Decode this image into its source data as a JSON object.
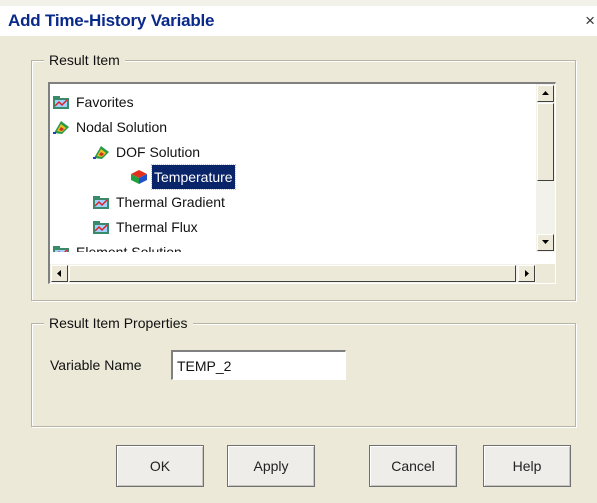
{
  "window": {
    "title": "Add Time-History Variable",
    "close_glyph": "×"
  },
  "result_item": {
    "group_label": "Result Item",
    "tree": [
      {
        "label": "Favorites",
        "icon": "folder-chart-icon",
        "level": 0,
        "selected": false
      },
      {
        "label": "Nodal Solution",
        "icon": "nodal-solution-icon",
        "level": 0,
        "selected": false
      },
      {
        "label": "DOF Solution",
        "icon": "nodal-solution-icon",
        "level": 1,
        "selected": false
      },
      {
        "label": "Temperature",
        "icon": "temperature-cube-icon",
        "level": 2,
        "selected": true
      },
      {
        "label": "Thermal Gradient",
        "icon": "folder-chart-icon",
        "level": 1,
        "selected": false
      },
      {
        "label": "Thermal Flux",
        "icon": "folder-chart-icon",
        "level": 1,
        "selected": false
      },
      {
        "label": "Element Solution",
        "icon": "folder-chart-icon",
        "level": 0,
        "selected": false
      }
    ]
  },
  "properties": {
    "group_label": "Result Item Properties",
    "variable_name_label": "Variable Name",
    "variable_name_value": "TEMP_2"
  },
  "buttons": {
    "ok": "OK",
    "apply": "Apply",
    "cancel": "Cancel",
    "help": "Help"
  },
  "colors": {
    "selection": "#0a246a",
    "title_text": "#0a2a8a",
    "dialog_bg": "#ece9d8"
  }
}
